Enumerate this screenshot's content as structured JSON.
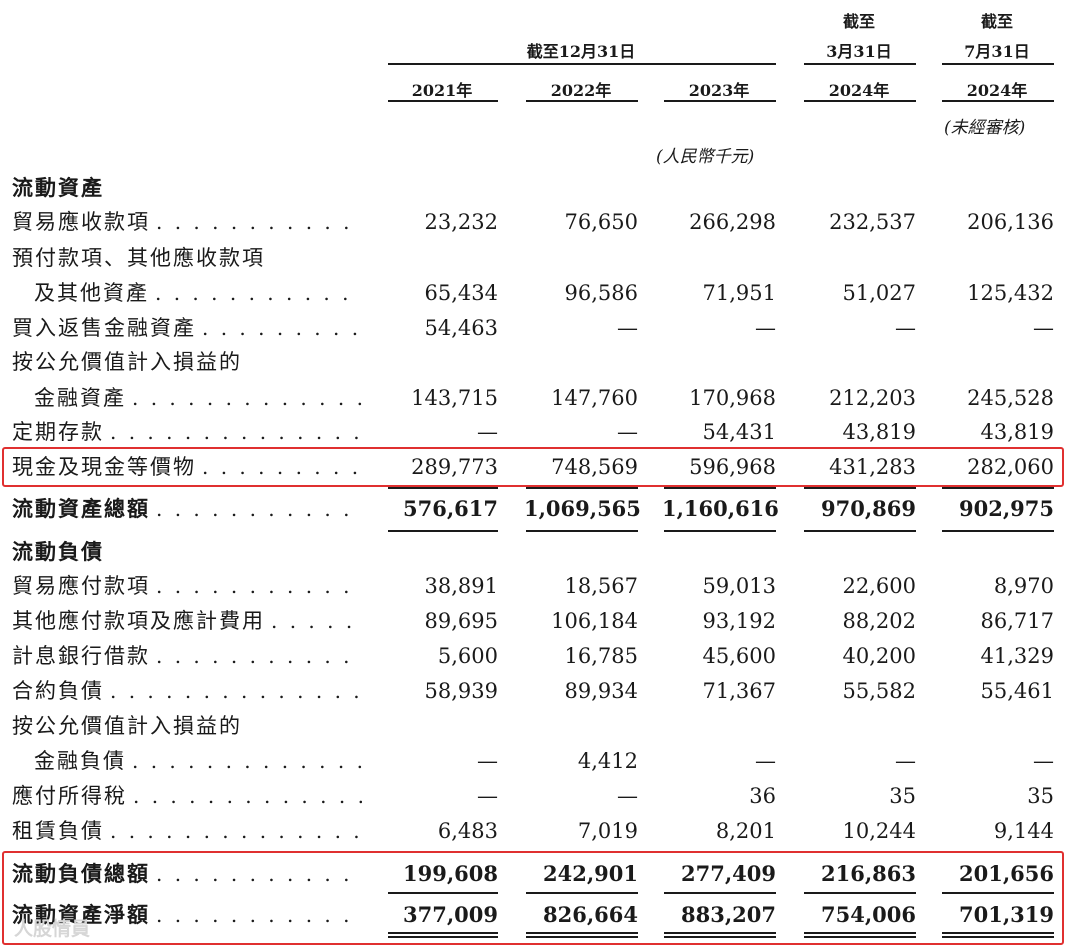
{
  "header": {
    "group_title": "截至12月31日",
    "col3_top1": "截至",
    "col3_top2": "3月31日",
    "col4_top1": "截至",
    "col4_top2": "7月31日",
    "years": [
      "2021年",
      "2022年",
      "2023年",
      "2024年",
      "2024年"
    ],
    "unaudited": "(未經審核)",
    "unit": "(人民幣千元)"
  },
  "rows": [
    {
      "label": "流動資產",
      "bold": true
    },
    {
      "label": "貿易應收款項",
      "values": [
        "23,232",
        "76,650",
        "266,298",
        "232,537",
        "206,136"
      ]
    },
    {
      "label": "預付款項、其他應收款項"
    },
    {
      "label": "及其他資產",
      "indent": true,
      "values": [
        "65,434",
        "96,586",
        "71,951",
        "51,027",
        "125,432"
      ]
    },
    {
      "label": "買入返售金融資產",
      "values": [
        "54,463",
        "—",
        "—",
        "—",
        "—"
      ]
    },
    {
      "label": "按公允價值計入損益的"
    },
    {
      "label": "金融資產",
      "indent": true,
      "values": [
        "143,715",
        "147,760",
        "170,968",
        "212,203",
        "245,528"
      ]
    },
    {
      "label": "定期存款",
      "values": [
        "—",
        "—",
        "54,431",
        "43,819",
        "43,819"
      ]
    },
    {
      "label": "現金及現金等價物",
      "values": [
        "289,773",
        "748,569",
        "596,968",
        "431,283",
        "282,060"
      ]
    },
    {
      "label": "流動資產總額",
      "bold": true,
      "values": [
        "576,617",
        "1,069,565",
        "1,160,616",
        "970,869",
        "902,975"
      ]
    },
    {
      "label": "流動負債",
      "bold": true
    },
    {
      "label": "貿易應付款項",
      "values": [
        "38,891",
        "18,567",
        "59,013",
        "22,600",
        "8,970"
      ]
    },
    {
      "label": "其他應付款項及應計費用",
      "values": [
        "89,695",
        "106,184",
        "93,192",
        "88,202",
        "86,717"
      ]
    },
    {
      "label": "計息銀行借款",
      "values": [
        "5,600",
        "16,785",
        "45,600",
        "40,200",
        "41,329"
      ]
    },
    {
      "label": "合約負債",
      "values": [
        "58,939",
        "89,934",
        "71,367",
        "55,582",
        "55,461"
      ]
    },
    {
      "label": "按公允價值計入損益的"
    },
    {
      "label": "金融負債",
      "indent": true,
      "values": [
        "—",
        "4,412",
        "—",
        "—",
        "—"
      ]
    },
    {
      "label": "應付所得稅",
      "values": [
        "—",
        "—",
        "36",
        "35",
        "35"
      ]
    },
    {
      "label": "租賃負債",
      "values": [
        "6,483",
        "7,019",
        "8,201",
        "10,244",
        "9,144"
      ]
    },
    {
      "label": "流動負債總額",
      "bold": true,
      "values": [
        "199,608",
        "242,901",
        "277,409",
        "216,863",
        "201,656"
      ]
    },
    {
      "label": "流動資產淨額",
      "bold": true,
      "values": [
        "377,009",
        "826,664",
        "883,207",
        "754,006",
        "701,319"
      ]
    }
  ],
  "highlight_color": "#e03030",
  "watermark": "人股情員"
}
